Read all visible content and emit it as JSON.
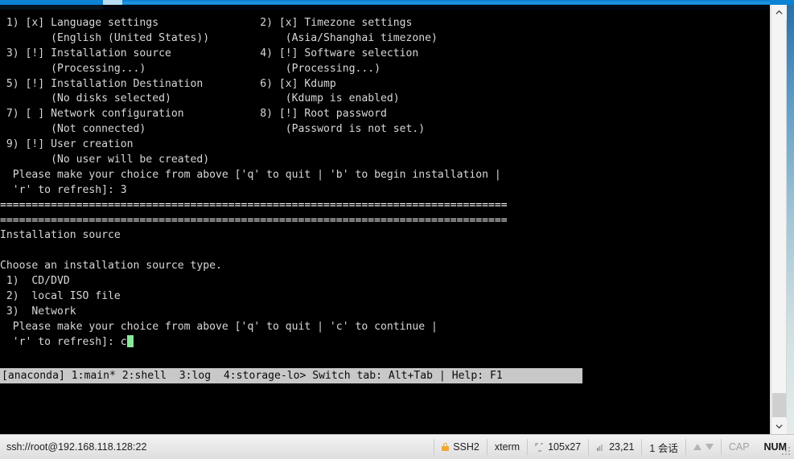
{
  "window": {
    "accent_color": "#0c82d4"
  },
  "terminal": {
    "background": "#000000",
    "foreground": "#d8d8d8",
    "cursor_color": "#8ae89a",
    "lines": [
      " 1) [x] Language settings                2) [x] Timezone settings",
      "        (English (United States))            (Asia/Shanghai timezone)",
      " 3) [!] Installation source              4) [!] Software selection",
      "        (Processing...)                      (Processing...)",
      " 5) [!] Installation Destination         6) [x] Kdump",
      "        (No disks selected)                  (Kdump is enabled)",
      " 7) [ ] Network configuration            8) [!] Root password",
      "        (Not connected)                      (Password is not set.)",
      " 9) [!] User creation",
      "        (No user will be created)",
      "  Please make your choice from above ['q' to quit | 'b' to begin installation |",
      "  'r' to refresh]: 3",
      "================================================================================",
      "================================================================================",
      "Installation source",
      "",
      "Choose an installation source type.",
      " 1)  CD/DVD",
      " 2)  local ISO file",
      " 3)  Network",
      "  Please make your choice from above ['q' to quit | 'c' to continue |",
      "  'r' to refresh]: c"
    ],
    "prompt_typed_value": "c",
    "anaconda_bar": "[anaconda] 1:main* 2:shell  3:log  4:storage-lo> Switch tab: Alt+Tab | Help: F1"
  },
  "scrollbar": {
    "up_arrow": "chevron-up-icon",
    "down_arrow": "chevron-down-icon"
  },
  "statusbar": {
    "connection": "ssh://root@192.168.118.128:22",
    "protocol": "SSH2",
    "emulation": "xterm",
    "size": "105x27",
    "cursor_position": "23,21",
    "sessions": "1 会话",
    "caps_lock": "CAP",
    "num_lock": "NUM",
    "lock_icon": "lock-icon",
    "term_size_icon": "terminal-size-icon",
    "cursor_pos_icon": "cursor-position-icon",
    "upload_icon": "arrow-up-icon",
    "download_icon": "arrow-down-icon",
    "grip_icon": "resize-grip-icon"
  }
}
